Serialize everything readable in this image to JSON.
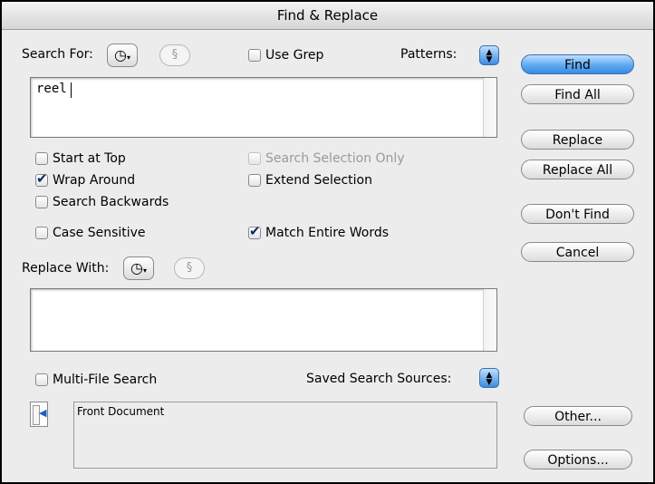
{
  "window": {
    "title": "Find & Replace"
  },
  "search": {
    "label": "Search For:",
    "value": "reel",
    "use_grep": {
      "label": "Use Grep",
      "checked": false
    },
    "patterns_label": "Patterns:",
    "section_glyph": "§"
  },
  "options": {
    "start_at_top": {
      "label": "Start at Top",
      "checked": false
    },
    "wrap_around": {
      "label": "Wrap Around",
      "checked": true
    },
    "search_backwards": {
      "label": "Search Backwards",
      "checked": false
    },
    "case_sensitive": {
      "label": "Case Sensitive",
      "checked": false
    },
    "search_selection_only": {
      "label": "Search Selection Only",
      "checked": false,
      "disabled": true
    },
    "extend_selection": {
      "label": "Extend Selection",
      "checked": false
    },
    "match_entire_words": {
      "label": "Match Entire Words",
      "checked": true
    }
  },
  "replace": {
    "label": "Replace With:",
    "value": "",
    "section_glyph": "§"
  },
  "multifile": {
    "label": "Multi-File Search",
    "checked": false,
    "saved_sources_label": "Saved Search Sources:",
    "sources": [
      "Front Document"
    ]
  },
  "buttons": {
    "find": "Find",
    "find_all": "Find All",
    "replace": "Replace",
    "replace_all": "Replace All",
    "dont_find": "Don't Find",
    "cancel": "Cancel",
    "other": "Other...",
    "options": "Options..."
  },
  "icons": {
    "history_menu": "clock-menu-icon",
    "popup": "updown-arrows-icon",
    "source_list": "document-arrow-icon"
  },
  "colors": {
    "default_button": "#3b8be0",
    "window_bg": "#ececec"
  }
}
